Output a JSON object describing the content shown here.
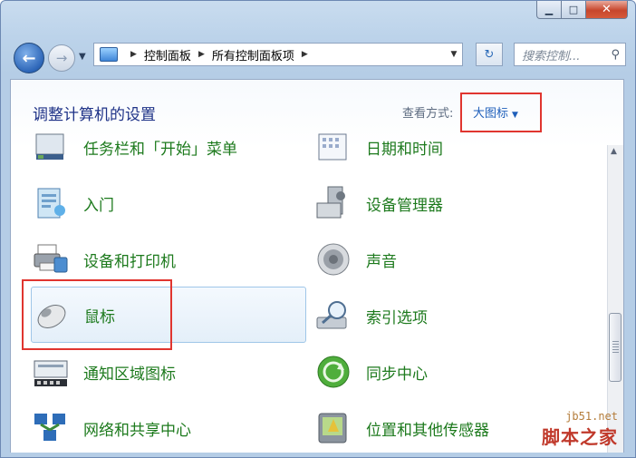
{
  "window": {
    "minimize_glyph": "▁",
    "maximize_glyph": "□",
    "close_glyph": "✕"
  },
  "nav": {
    "back_glyph": "←",
    "forward_glyph": "→",
    "breadcrumb": [
      "控制面板",
      "所有控制面板项"
    ],
    "refresh_glyph": "↻",
    "search_placeholder": "搜索控制...",
    "search_icon": "search-icon"
  },
  "content": {
    "heading": "调整计算机的设置",
    "view_by_label": "查看方式:",
    "view_by_value": "大图标",
    "left_items": [
      {
        "label": "任务栏和「开始」菜单",
        "icon": "taskbar-icon"
      },
      {
        "label": "入门",
        "icon": "getting-started-icon"
      },
      {
        "label": "设备和打印机",
        "icon": "printer-icon"
      },
      {
        "label": "鼠标",
        "icon": "mouse-icon"
      },
      {
        "label": "通知区域图标",
        "icon": "notification-area-icon"
      },
      {
        "label": "网络和共享中心",
        "icon": "network-icon"
      }
    ],
    "right_items": [
      {
        "label": "日期和时间",
        "icon": "calendar-icon"
      },
      {
        "label": "设备管理器",
        "icon": "device-manager-icon"
      },
      {
        "label": "声音",
        "icon": "speaker-icon"
      },
      {
        "label": "索引选项",
        "icon": "indexing-icon"
      },
      {
        "label": "同步中心",
        "icon": "sync-icon"
      },
      {
        "label": "位置和其他传感器",
        "icon": "location-sensor-icon"
      }
    ]
  },
  "watermark": {
    "url": "jb51.net",
    "name": "脚本之家"
  },
  "colors": {
    "link_green": "#1d7a1d",
    "heading_blue": "#1e3287",
    "highlight_red": "#e0352f"
  }
}
